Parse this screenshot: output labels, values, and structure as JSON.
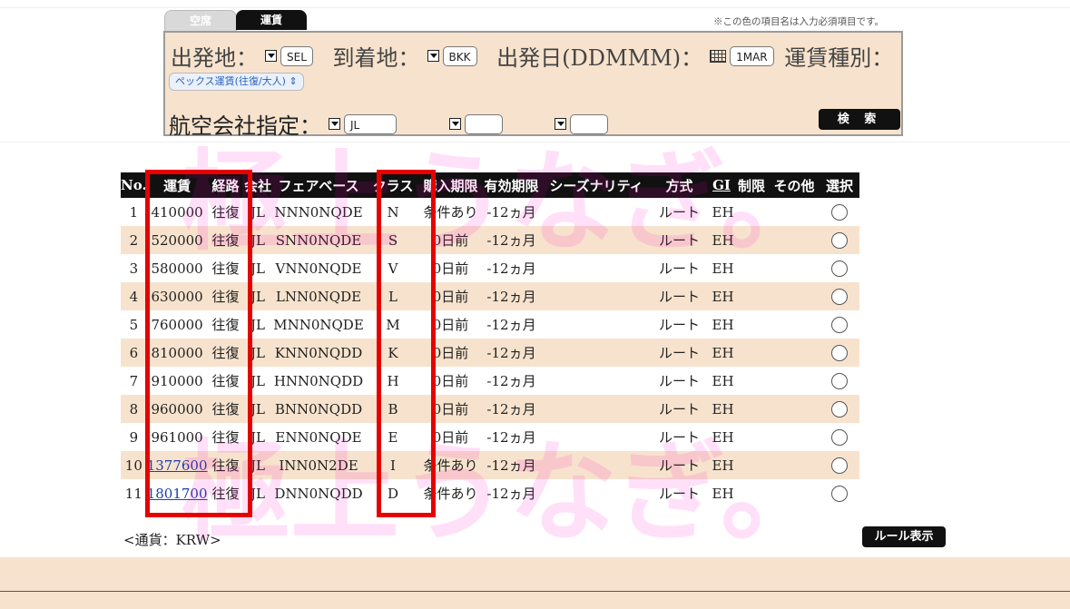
{
  "tabs": [
    {
      "label": "空席",
      "active": false
    },
    {
      "label": "運賃",
      "active": true
    }
  ],
  "required_note": "※この色の項目名は入力必須項目です。",
  "search": {
    "departure_label": "出発地：",
    "departure_value": "SEL",
    "arrival_label": "到着地：",
    "arrival_value": "BKK",
    "date_label": "出発日(DDMMM)：",
    "date_value": "1MAR",
    "fare_type_label": "運賃種別：",
    "fare_type_value": "ペックス運賃(往復/大人)",
    "airline_label": "航空会社指定：",
    "airline_value": "JL",
    "airline_value_2": "",
    "airline_value_3": "",
    "search_button": "検 索"
  },
  "watermark": {
    "line1": "極上うなぎ。",
    "line2": "極上うなぎ。"
  },
  "table": {
    "columns": [
      "No.",
      "運賃",
      "経路",
      "会社",
      "フェアベース",
      "クラス",
      "購入期限",
      "有効期限",
      "シーズナリティ",
      "方式",
      "GI",
      "制限",
      "その他",
      "選択"
    ],
    "rows": [
      {
        "no": "1",
        "fare": "410000",
        "route": "往復",
        "airline": "JL",
        "fare_basis": "NNN0NQDE",
        "class": "N",
        "purchase": "条件あり",
        "validity": "-12ヵ月",
        "season": "",
        "method": "ルート",
        "gi": "EH",
        "restriction": "",
        "other": "",
        "link": false
      },
      {
        "no": "2",
        "fare": "520000",
        "route": "往復",
        "airline": "JL",
        "fare_basis": "SNN0NQDE",
        "class": "S",
        "purchase": "0日前",
        "validity": "-12ヵ月",
        "season": "",
        "method": "ルート",
        "gi": "EH",
        "restriction": "",
        "other": "",
        "link": false
      },
      {
        "no": "3",
        "fare": "580000",
        "route": "往復",
        "airline": "JL",
        "fare_basis": "VNN0NQDE",
        "class": "V",
        "purchase": "0日前",
        "validity": "-12ヵ月",
        "season": "",
        "method": "ルート",
        "gi": "EH",
        "restriction": "",
        "other": "",
        "link": false
      },
      {
        "no": "4",
        "fare": "630000",
        "route": "往復",
        "airline": "JL",
        "fare_basis": "LNN0NQDE",
        "class": "L",
        "purchase": "0日前",
        "validity": "-12ヵ月",
        "season": "",
        "method": "ルート",
        "gi": "EH",
        "restriction": "",
        "other": "",
        "link": false
      },
      {
        "no": "5",
        "fare": "760000",
        "route": "往復",
        "airline": "JL",
        "fare_basis": "MNN0NQDE",
        "class": "M",
        "purchase": "0日前",
        "validity": "-12ヵ月",
        "season": "",
        "method": "ルート",
        "gi": "EH",
        "restriction": "",
        "other": "",
        "link": false
      },
      {
        "no": "6",
        "fare": "810000",
        "route": "往復",
        "airline": "JL",
        "fare_basis": "KNN0NQDD",
        "class": "K",
        "purchase": "0日前",
        "validity": "-12ヵ月",
        "season": "",
        "method": "ルート",
        "gi": "EH",
        "restriction": "",
        "other": "",
        "link": false
      },
      {
        "no": "7",
        "fare": "910000",
        "route": "往復",
        "airline": "JL",
        "fare_basis": "HNN0NQDD",
        "class": "H",
        "purchase": "0日前",
        "validity": "-12ヵ月",
        "season": "",
        "method": "ルート",
        "gi": "EH",
        "restriction": "",
        "other": "",
        "link": false
      },
      {
        "no": "8",
        "fare": "960000",
        "route": "往復",
        "airline": "JL",
        "fare_basis": "BNN0NQDD",
        "class": "B",
        "purchase": "0日前",
        "validity": "-12ヵ月",
        "season": "",
        "method": "ルート",
        "gi": "EH",
        "restriction": "",
        "other": "",
        "link": false
      },
      {
        "no": "9",
        "fare": "961000",
        "route": "往復",
        "airline": "JL",
        "fare_basis": "ENN0NQDE",
        "class": "E",
        "purchase": "0日前",
        "validity": "-12ヵ月",
        "season": "",
        "method": "ルート",
        "gi": "EH",
        "restriction": "",
        "other": "",
        "link": false
      },
      {
        "no": "10",
        "fare": "1377600",
        "route": "往復",
        "airline": "JL",
        "fare_basis": "INN0N2DE",
        "class": "I",
        "purchase": "条件あり",
        "validity": "-12ヵ月",
        "season": "",
        "method": "ルート",
        "gi": "EH",
        "restriction": "",
        "other": "",
        "link": true
      },
      {
        "no": "11",
        "fare": "1801700",
        "route": "往復",
        "airline": "JL",
        "fare_basis": "DNN0NQDD",
        "class": "D",
        "purchase": "条件あり",
        "validity": "-12ヵ月",
        "season": "",
        "method": "ルート",
        "gi": "EH",
        "restriction": "",
        "other": "",
        "link": true
      }
    ]
  },
  "currency_note": "<通貨：KRW>",
  "rule_button": "ルール表示",
  "colors": {
    "accent_bg": "#f7e3cd",
    "header_bg": "#111111",
    "highlight": "#e60000",
    "link": "#1a3fb0"
  }
}
